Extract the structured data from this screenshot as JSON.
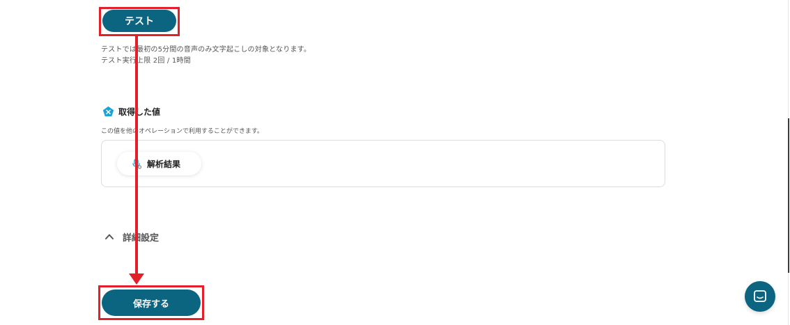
{
  "test_button": {
    "label": "テスト"
  },
  "test_notes": {
    "line1": "テストでは最初の5分間の音声のみ文字起こしの対象となります。",
    "line2": "テスト実行上限 2回 / 1時間"
  },
  "output_section": {
    "title": "取得した値",
    "icon": "x-pentagon-icon",
    "description": "この値を他のオペレーションで利用することができます。",
    "items": [
      {
        "label": "解析結果",
        "icon": "microphone-icon"
      }
    ]
  },
  "advanced_settings": {
    "label": "詳細設定",
    "icon": "chevron-up-icon"
  },
  "save_button": {
    "label": "保存する"
  },
  "chat_widget": {
    "icon": "chat-icon"
  },
  "colors": {
    "primary": "#0b6581",
    "annotation_red": "#e1202a",
    "accent_cyan": "#1aa3d6"
  }
}
